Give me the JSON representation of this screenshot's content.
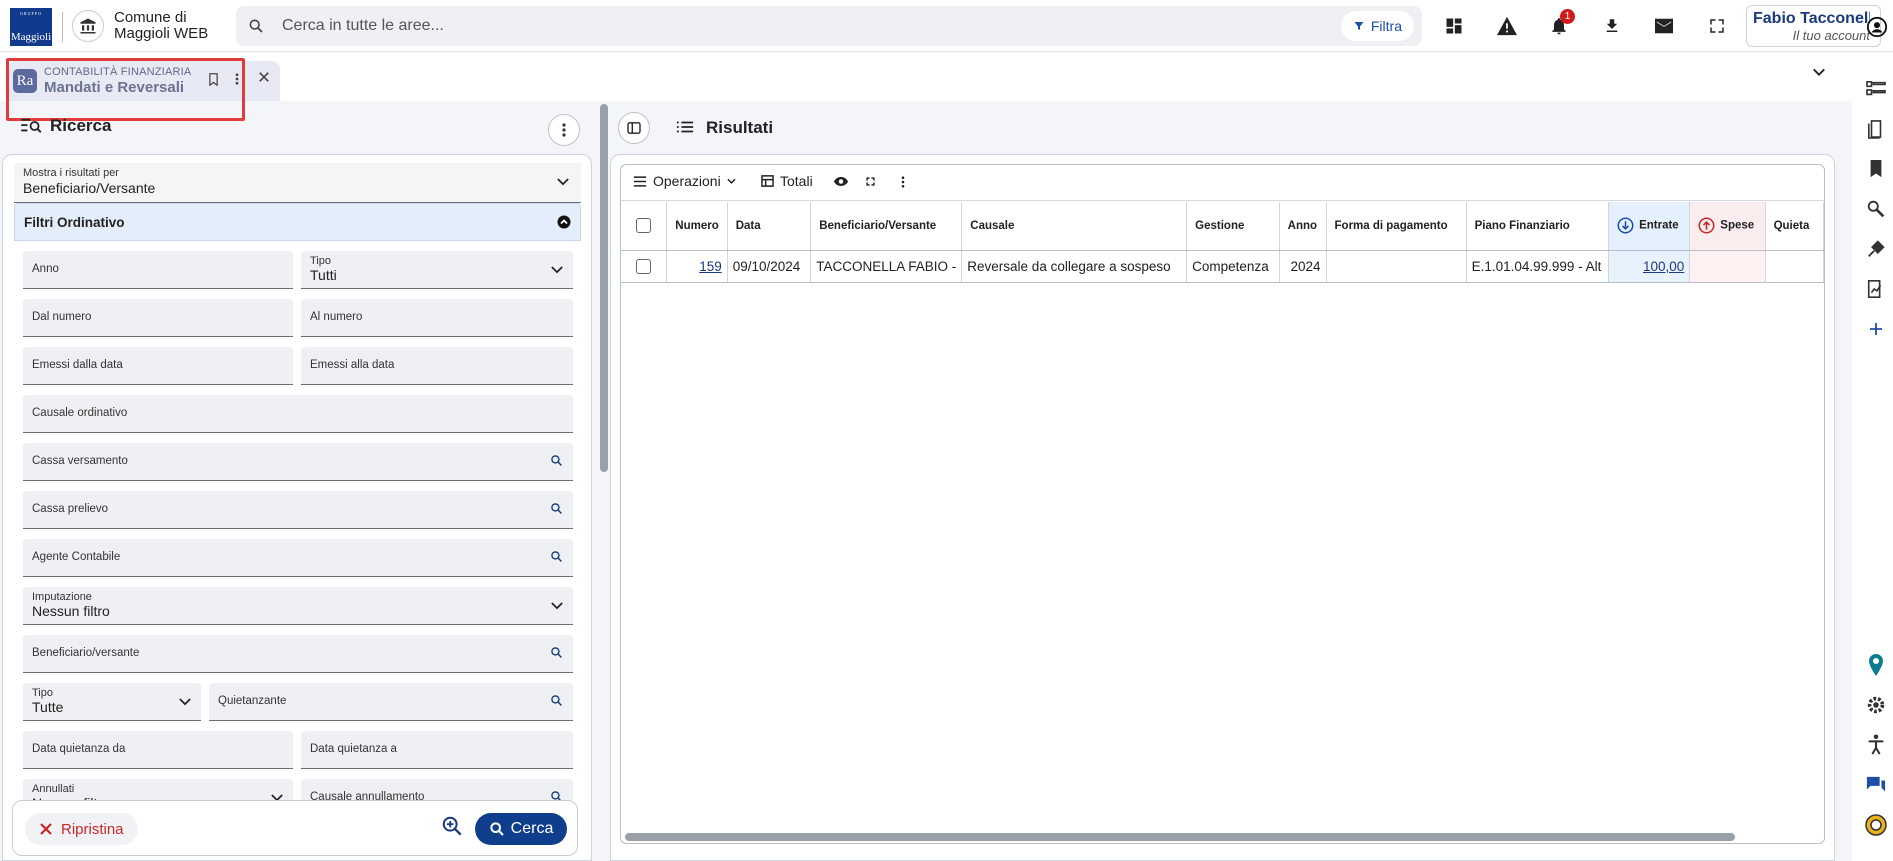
{
  "app": {
    "logo_small": "GRUPPO",
    "logo_text": "Maggioli",
    "comune_line1": "Comune di",
    "comune_line2": "Maggioli WEB"
  },
  "search": {
    "placeholder": "Cerca in tutte le aree...",
    "filter_label": "Filtra"
  },
  "notifications": {
    "count": "1"
  },
  "account": {
    "name": "Fabio Tacconell...",
    "subtitle": "Il tuo account"
  },
  "tab": {
    "badge": "Ra",
    "category": "CONTABILITÀ FINANZIARIA",
    "title": "Mandati e Reversali"
  },
  "left": {
    "title": "Ricerca",
    "mostra_label": "Mostra i risultati per",
    "mostra_value": "Beneficiario/Versante",
    "section_title": "Filtri Ordinativo",
    "fields": {
      "anno": "Anno",
      "tipo_label": "Tipo",
      "tipo_value": "Tutti",
      "dal_numero": "Dal numero",
      "al_numero": "Al numero",
      "emessi_dalla": "Emessi dalla data",
      "emessi_alla": "Emessi alla data",
      "causale_ordinativo": "Causale ordinativo",
      "cassa_versamento": "Cassa versamento",
      "cassa_prelievo": "Cassa prelievo",
      "agente_contabile": "Agente Contabile",
      "imputazione_label": "Imputazione",
      "imputazione_value": "Nessun filtro",
      "beneficiario": "Beneficiario/versante",
      "tipo2_label": "Tipo",
      "tipo2_value": "Tutte",
      "quietanzante": "Quietanzante",
      "data_quietanza_da": "Data quietanza da",
      "data_quietanza_a": "Data quietanza a",
      "annullati_label": "Annullati",
      "annullati_value": "Nessun filtro",
      "causale_annullamento": "Causale annullamento"
    },
    "reset_label": "Ripristina",
    "search_label": "Cerca"
  },
  "right": {
    "title": "Risultati",
    "toolbar": {
      "operazioni": "Operazioni",
      "totali": "Totali"
    },
    "columns": [
      "Numero",
      "Data",
      "Beneficiario/Versante",
      "Causale",
      "Gestione",
      "Anno",
      "Forma di pagamento",
      "Piano Finanziario",
      "Entrate",
      "Spese",
      "Quieta"
    ],
    "rows": [
      {
        "numero": "159",
        "data": "09/10/2024",
        "beneficiario": "TACCONELLA FABIO -",
        "causale": "Reversale da collegare a sospeso",
        "gestione": "Competenza",
        "anno": "2024",
        "forma": "",
        "piano": "E.1.01.04.99.999 - Alt",
        "entrate": "100,00",
        "spese": "",
        "quieta": ""
      }
    ]
  },
  "colors": {
    "accent": "#0f3f8c",
    "entrate": "#1d4fa8",
    "spese": "#c62828",
    "highlight": "#e23b3b"
  }
}
